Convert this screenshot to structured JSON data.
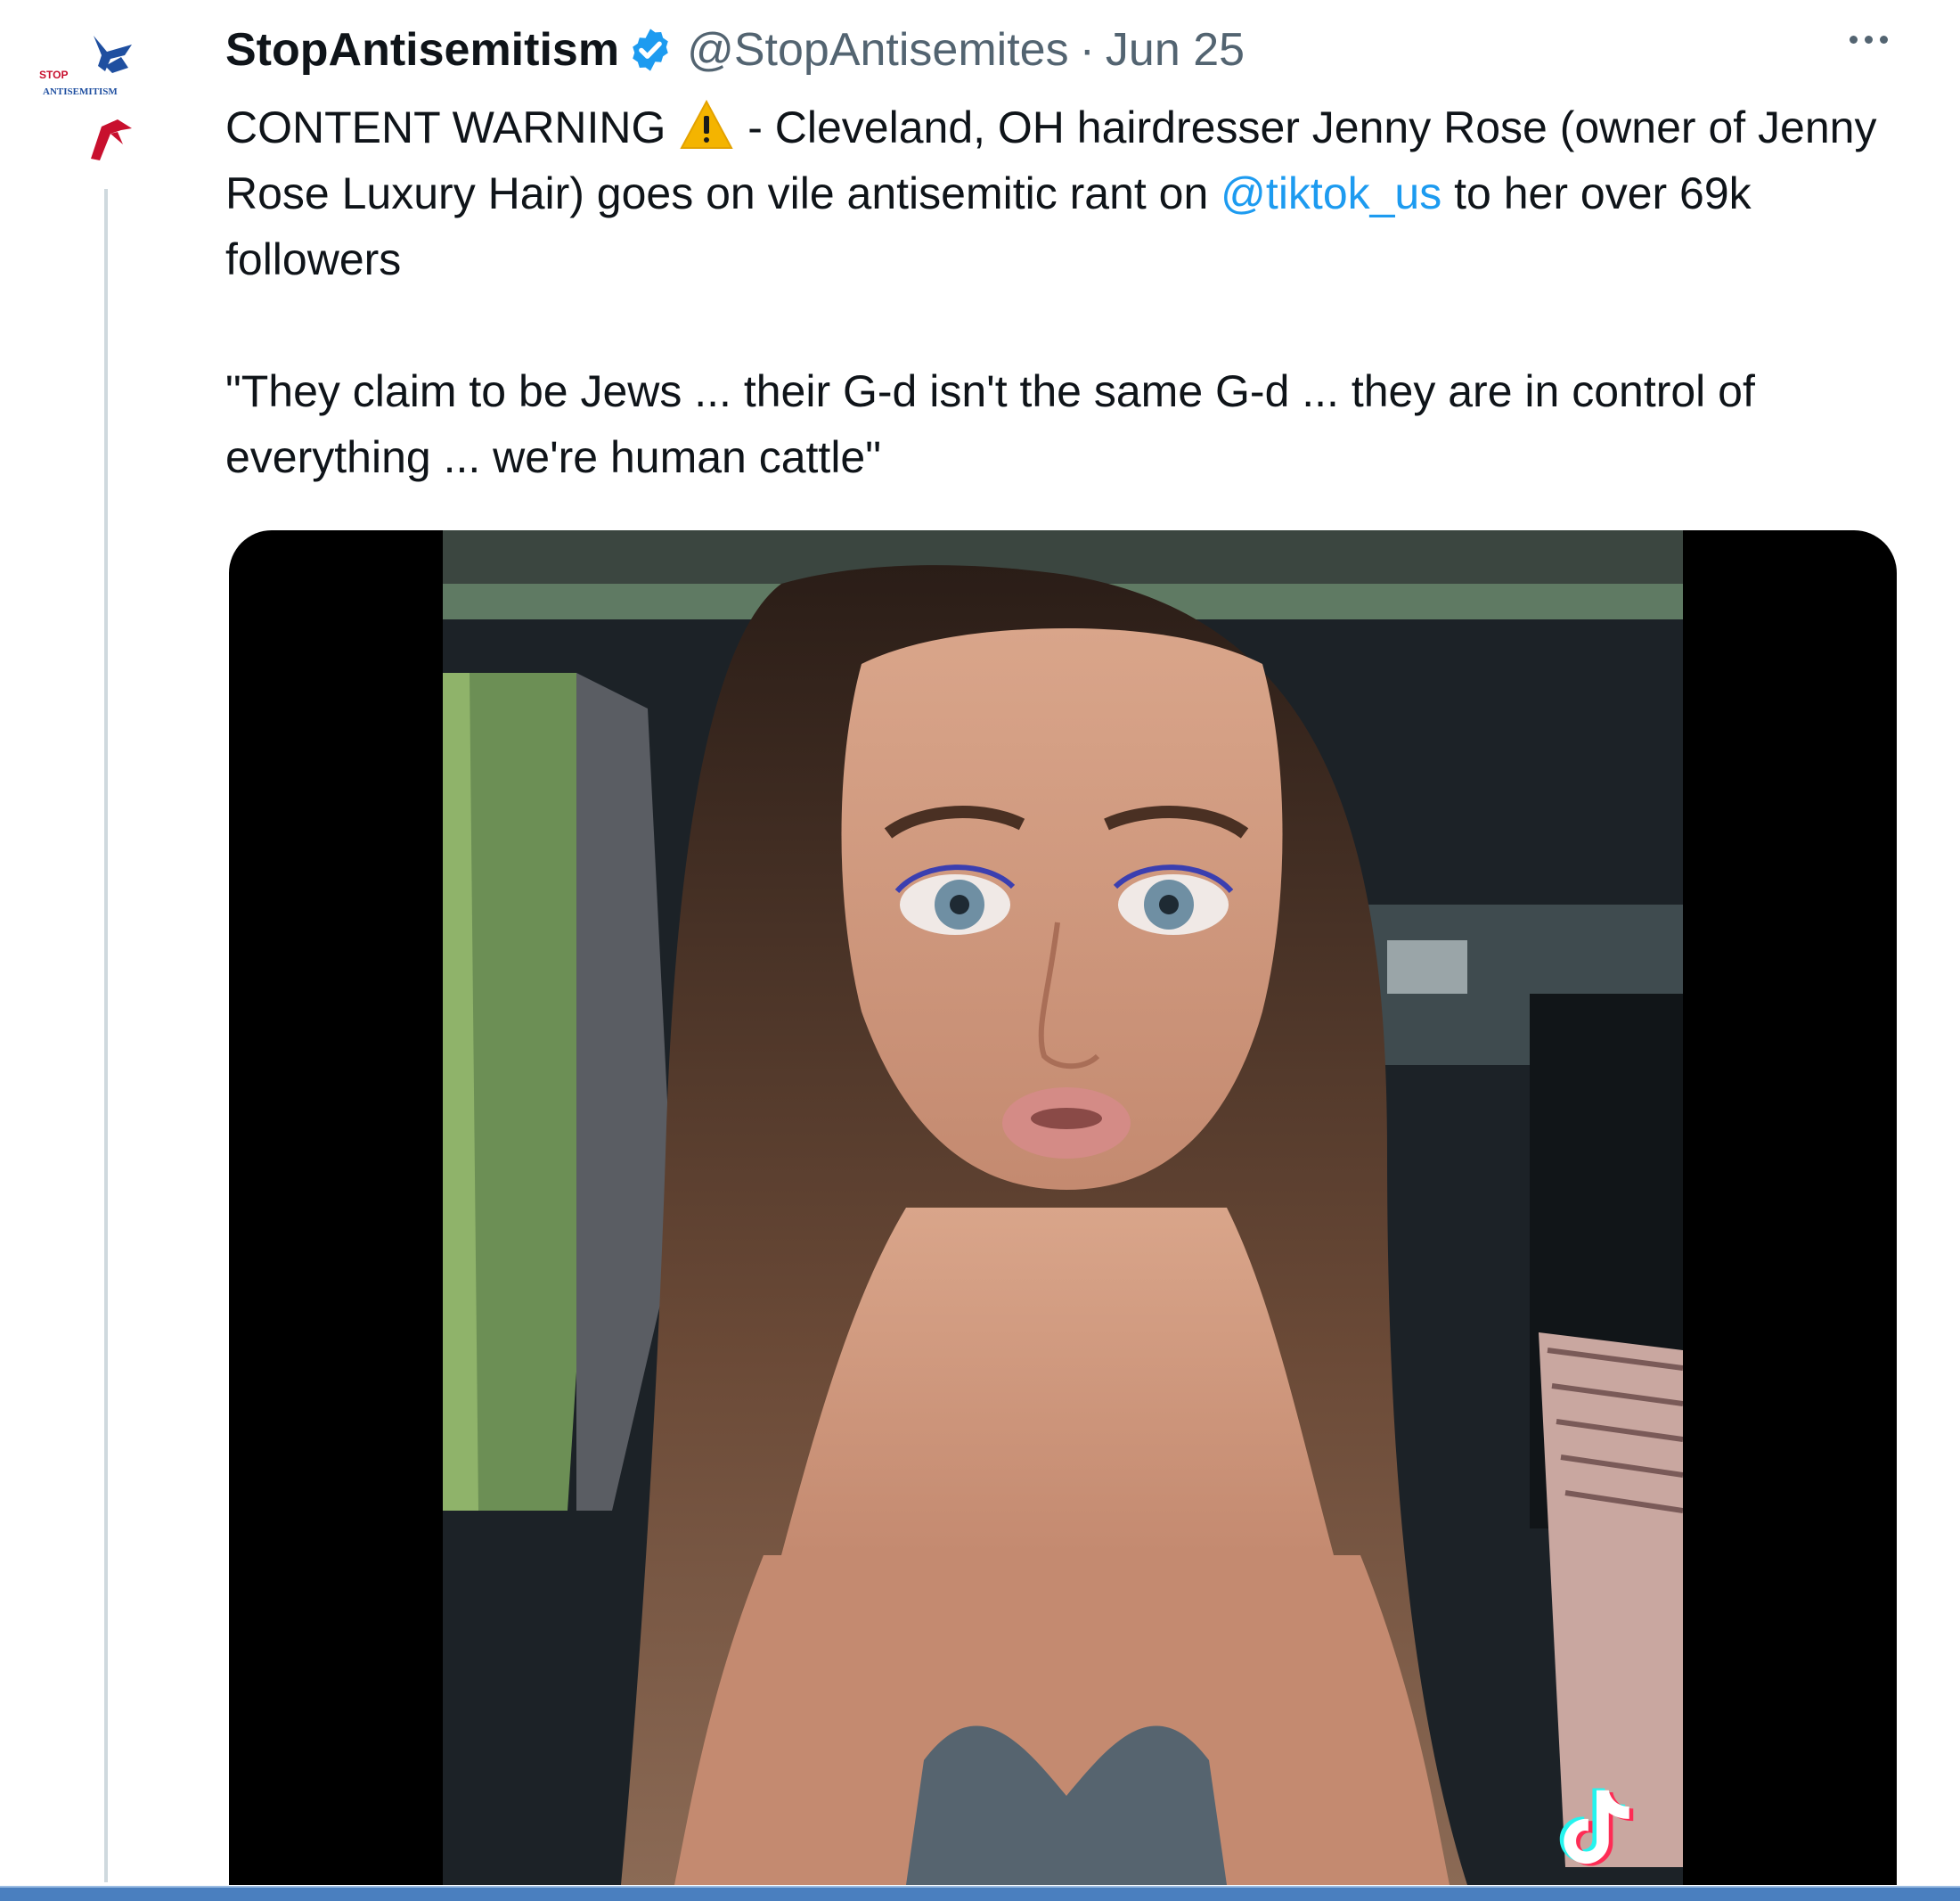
{
  "tweet": {
    "author": {
      "display_name": "StopAntisemitism",
      "handle": "@StopAntisemites",
      "verified": true,
      "avatar_text_top": "STOP",
      "avatar_text_bottom": "ANTISEMITISM"
    },
    "separator": "·",
    "date": "Jun 25",
    "text": {
      "part1": "CONTENT WARNING ",
      "part2": " - Cleveland, OH hairdresser Jenny Rose (owner of Jenny Rose Luxury Hair) goes on vile antisemitic rant on ",
      "mention": "@tiktok_us",
      "part3": " to her over 69k followers",
      "quote": "\"They claim to be Jews ... their G-d isn't the same G-d ...  they are in control of everything ... we're human cattle\""
    },
    "media": {
      "type": "video",
      "watermark_icon": "tiktok-icon"
    }
  },
  "colors": {
    "link": "#1d9bf0",
    "secondary_text": "#536471",
    "verified_badge": "#1d9bf0",
    "warning": "#f4b400",
    "thread_line": "#cfd9de"
  }
}
